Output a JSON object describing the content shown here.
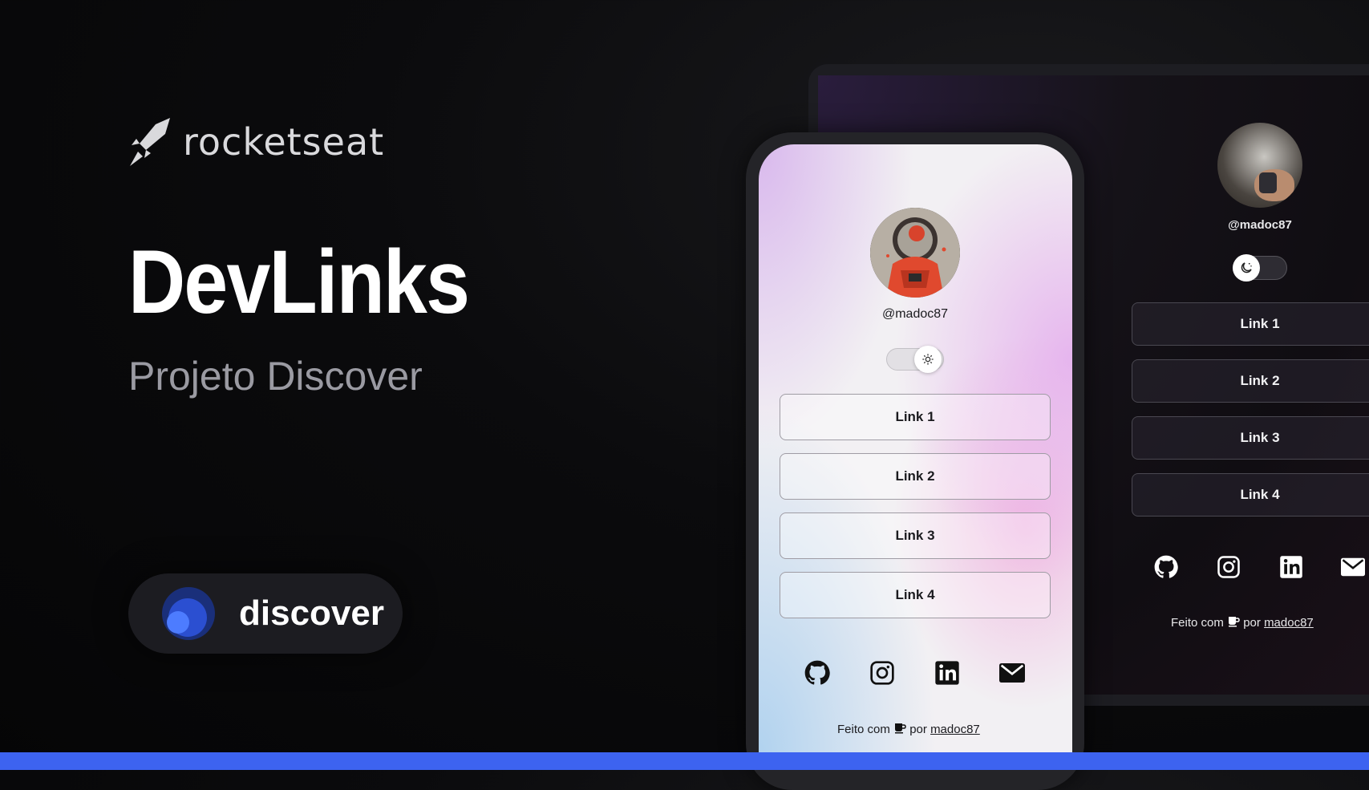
{
  "brand": {
    "name": "rocketseat",
    "icon": "rocket-icon"
  },
  "headline": "DevLinks",
  "subheadline": "Projeto Discover",
  "discover_badge": {
    "label": "discover",
    "icon": "discover-logo"
  },
  "colors": {
    "accent_bar": "#3d63f0",
    "background": "#0b0b0d",
    "phone_link_border": "#9f9ca4",
    "desktop_link_border": "#4a4851"
  },
  "phone": {
    "theme": "light",
    "username": "@madoc87",
    "toggle": {
      "state": "light",
      "icon": "sun-icon"
    },
    "links": [
      {
        "label": "Link 1"
      },
      {
        "label": "Link 2"
      },
      {
        "label": "Link 3"
      },
      {
        "label": "Link 4"
      }
    ],
    "socials": [
      "github-icon",
      "instagram-icon",
      "linkedin-icon",
      "mail-icon"
    ],
    "footer": {
      "prefix": "Feito com",
      "icon": "coffee-icon",
      "middle": "por",
      "author": "madoc87"
    }
  },
  "desktop": {
    "theme": "dark",
    "username": "@madoc87",
    "toggle": {
      "state": "dark",
      "icon": "moon-icon"
    },
    "links": [
      {
        "label": "Link 1"
      },
      {
        "label": "Link 2"
      },
      {
        "label": "Link 3"
      },
      {
        "label": "Link 4"
      }
    ],
    "socials": [
      "github-icon",
      "instagram-icon",
      "linkedin-icon",
      "mail-icon"
    ],
    "footer": {
      "prefix": "Feito com",
      "icon": "coffee-icon",
      "middle": "por",
      "author": "madoc87"
    }
  }
}
